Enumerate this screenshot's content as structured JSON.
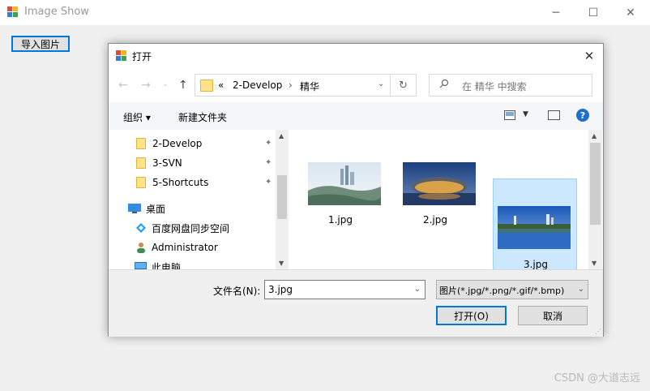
{
  "app": {
    "title": "Image Show",
    "import_button": "导入图片",
    "watermark": "CSDN @大道志远"
  },
  "dialog": {
    "title": "打开",
    "address": {
      "overflow": "«",
      "crumbs": [
        "2-Develop",
        "精华"
      ]
    },
    "search_placeholder": "在 精华 中搜索",
    "toolbar": {
      "organize": "组织 ▾",
      "new_folder": "新建文件夹"
    },
    "sidebar": {
      "items": [
        {
          "label": "2-Develop",
          "icon": "folder-icon",
          "pinned": true
        },
        {
          "label": "3-SVN",
          "icon": "folder-icon",
          "pinned": true
        },
        {
          "label": "5-Shortcuts",
          "icon": "folder-icon",
          "pinned": true
        },
        {
          "label": "桌面",
          "icon": "desktop-icon"
        },
        {
          "label": "百度网盘同步空间",
          "icon": "baidu-sync-icon"
        },
        {
          "label": "Administrator",
          "icon": "user-icon"
        },
        {
          "label": "此电脑",
          "icon": "computer-icon"
        }
      ]
    },
    "files": [
      {
        "name": "1.jpg",
        "selected": false
      },
      {
        "name": "2.jpg",
        "selected": false
      },
      {
        "name": "3.jpg",
        "selected": true
      },
      {
        "name": "",
        "selected": false
      }
    ],
    "filename_label": "文件名(N):",
    "filename_value": "3.jpg",
    "filter_value": "图片(*.jpg/*.png/*.gif/*.bmp)",
    "open_button": "打开(O)",
    "cancel_button": "取消"
  },
  "colors": {
    "accent": "#0078d7",
    "selection_bg": "#cce8ff",
    "selection_border": "#99d1ff"
  }
}
